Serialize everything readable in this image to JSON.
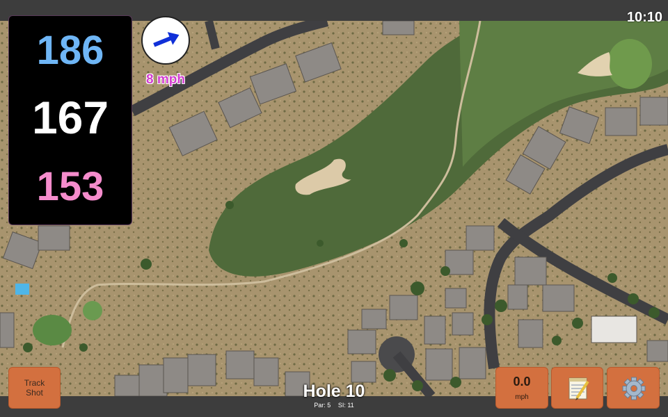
{
  "status": {
    "time": "10:10"
  },
  "distances": {
    "back": "186",
    "center": "167",
    "front": "153"
  },
  "wind": {
    "speed_label": "8 mph",
    "direction_deg": 68
  },
  "hole": {
    "title": "Hole 10",
    "par_label": "Par: 5",
    "si_label": "SI: 11"
  },
  "buttons": {
    "track_shot_line1": "Track",
    "track_shot_line2": "Shot",
    "speed_value": "0.0",
    "speed_unit": "mph",
    "notes_icon": "notepad-icon",
    "settings_icon": "gear-icon"
  },
  "colors": {
    "back": "#6fb6f6",
    "center": "#ffffff",
    "front": "#f58ccc",
    "wind": "#d23ed0",
    "button": "#d3703f"
  }
}
